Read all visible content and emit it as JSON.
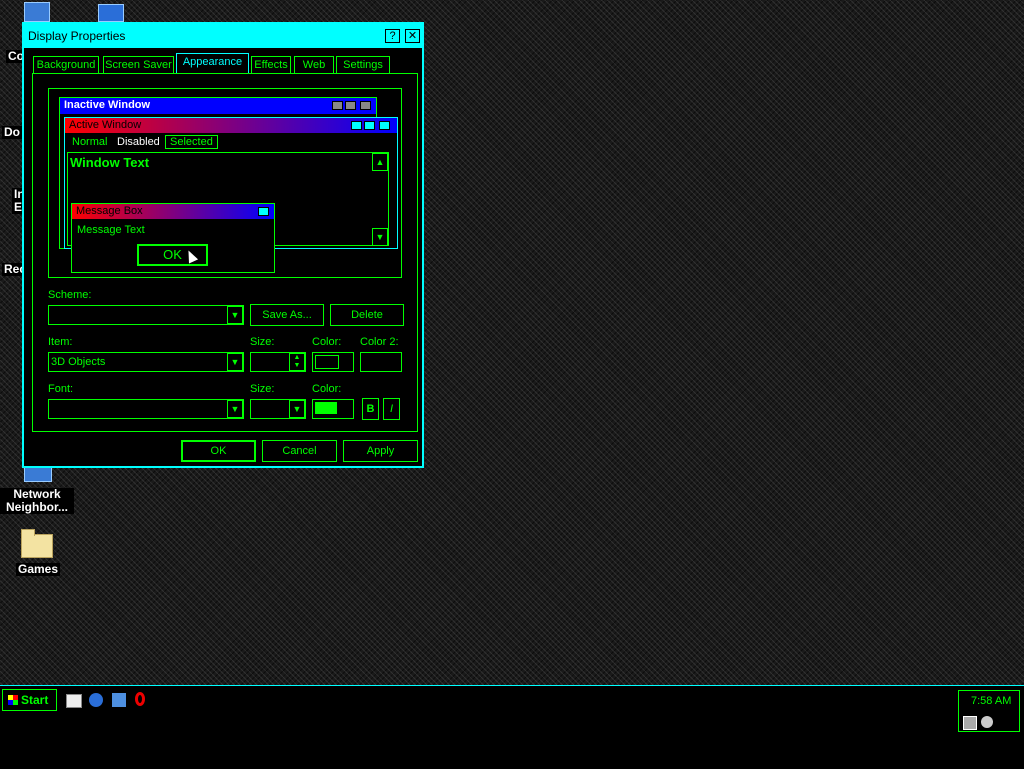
{
  "desktop": {
    "icons": [
      {
        "label": "Network Neighbor..."
      },
      {
        "label": "Games"
      }
    ],
    "partial_labels": [
      "Co",
      "Do",
      "In",
      "E",
      "Rec"
    ]
  },
  "dialog": {
    "title": "Display Properties",
    "help_btn": "?",
    "close_btn": "✕",
    "tabs": [
      "Background",
      "Screen Saver",
      "Appearance",
      "Effects",
      "Web",
      "Settings"
    ],
    "active_tab": "Appearance",
    "preview": {
      "inactive_title": "Inactive Window",
      "active_title": "Active Window",
      "menu": [
        "Normal",
        "Disabled",
        "Selected"
      ],
      "window_text": "Window Text",
      "msgbox_title": "Message Box",
      "msgbox_text": "Message Text",
      "msgbox_ok": "OK"
    },
    "scheme": {
      "label": "Scheme:",
      "value": "",
      "save_as": "Save As...",
      "delete": "Delete"
    },
    "item": {
      "label": "Item:",
      "value": "3D Objects",
      "size_label": "Size:",
      "color_label": "Color:",
      "color2_label": "Color 2:"
    },
    "font": {
      "label": "Font:",
      "value": "",
      "size_label": "Size:",
      "color_label": "Color:",
      "bold": "B",
      "italic": "I"
    },
    "buttons": {
      "ok": "OK",
      "cancel": "Cancel",
      "apply": "Apply"
    }
  },
  "taskbar": {
    "start_label": "Start",
    "clock": "7:58 AM"
  },
  "colors": {
    "accent_green": "#00ff00",
    "accent_cyan": "#00ffff",
    "active_title_start": "#ff0000",
    "active_title_end": "#0000ff",
    "inactive_title": "#0000ff",
    "item_color_swatch": "#000000",
    "font_color_swatch": "#00ff00"
  }
}
